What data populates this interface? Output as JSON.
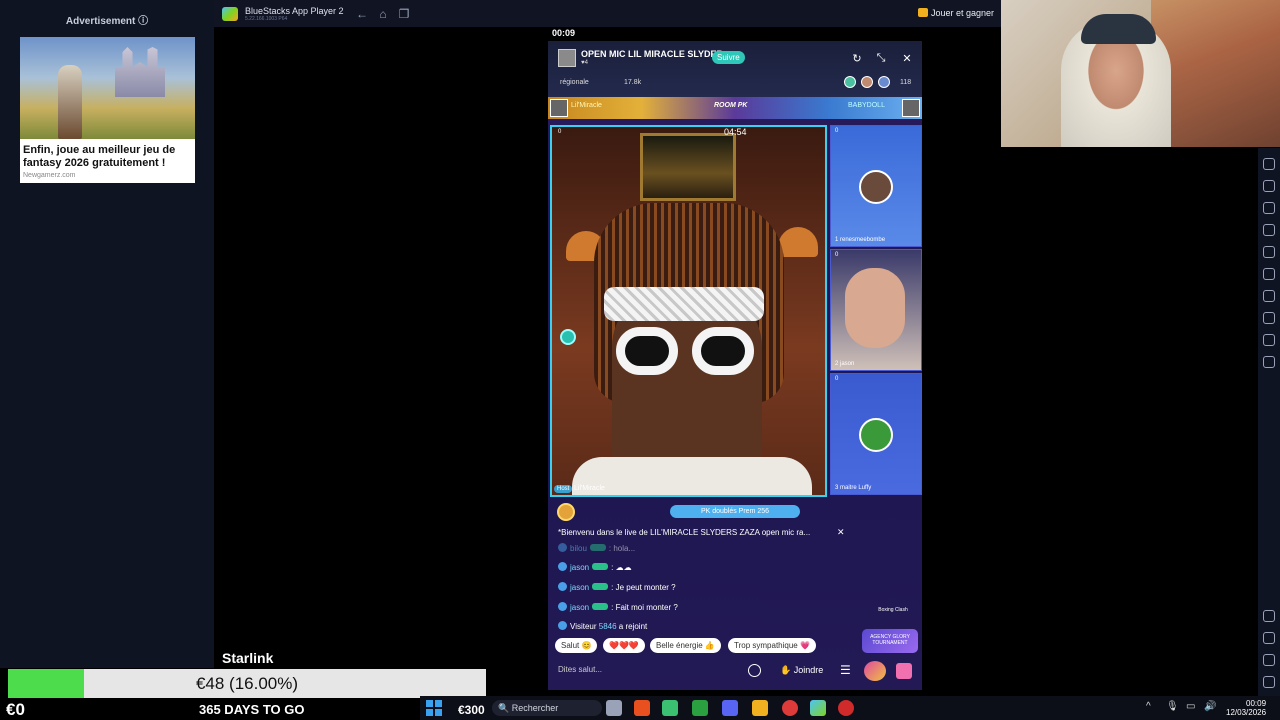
{
  "ad": {
    "label": "Advertisement ⓘ",
    "headline": "Enfin, joue au meilleur jeu de fantasy 2026 gratuitement !",
    "source": "Newgamerz.com"
  },
  "overlay": {
    "starlink": "Starlink",
    "progress_text": "€48 (16.00%)",
    "progress_fraction": 0.16,
    "euro_left": "€0",
    "days_label": "365 DAYS TO GO",
    "euro_mid": "€300"
  },
  "bluestacks": {
    "title": "BlueStacks App Player 2",
    "subtitle": "5.22.166.1003 P64",
    "earn_label": "Jouer et gagner"
  },
  "phone": {
    "time": "00:09",
    "room_title": "OPEN MIC LIL MIRACLE SLYDER",
    "hearts": "♥4",
    "follow": "Suivre",
    "region": "régionale",
    "coins": "17.8k",
    "viewers": "118",
    "pk_left_name": "Lil'Miracle",
    "pk_center": "ROOM PK",
    "pk_right_name": "BABYDOLL",
    "main_score": "0",
    "timer": "04:54",
    "host_label": "Host",
    "host_name": "Lil'Miracle",
    "slot1_num": "0",
    "slot1_name": "1 renesmeebombe",
    "slot2_num": "0",
    "slot2_name": "2 jason",
    "slot3_num": "0",
    "slot3_name": "3 maitre Luffy",
    "pk_status": "PK doublés   Prem  256",
    "welcome": "*Bienvenu dans le live de LIL'MIRACLE SLYDERS ZAZA open mic ra...",
    "chat": [
      {
        "user": "bilou",
        "msg": ": hola..."
      },
      {
        "user": "jason",
        "msg": ": ☁☁"
      },
      {
        "user": "jason",
        "msg": ": Je peut monter ?"
      },
      {
        "user": "jason",
        "msg": ": Fait moi monter ?"
      }
    ],
    "visitor_prefix": "Visiteur",
    "visitor_num": "5846",
    "visitor_suffix": "a rejoint",
    "quick_replies": [
      "Salut 😊",
      "❤️❤️❤️",
      "Belle énergie 👍",
      "Trop sympathique 💗"
    ],
    "input_placeholder": "Dites salut...",
    "join_label": "✋ Joindre",
    "boxing": "Boxing Clash",
    "agency": "AGENCY GLORY TOURNAMENT"
  },
  "taskbar": {
    "search_placeholder": "Rechercher",
    "time": "00:09",
    "date": "12/03/2026"
  }
}
